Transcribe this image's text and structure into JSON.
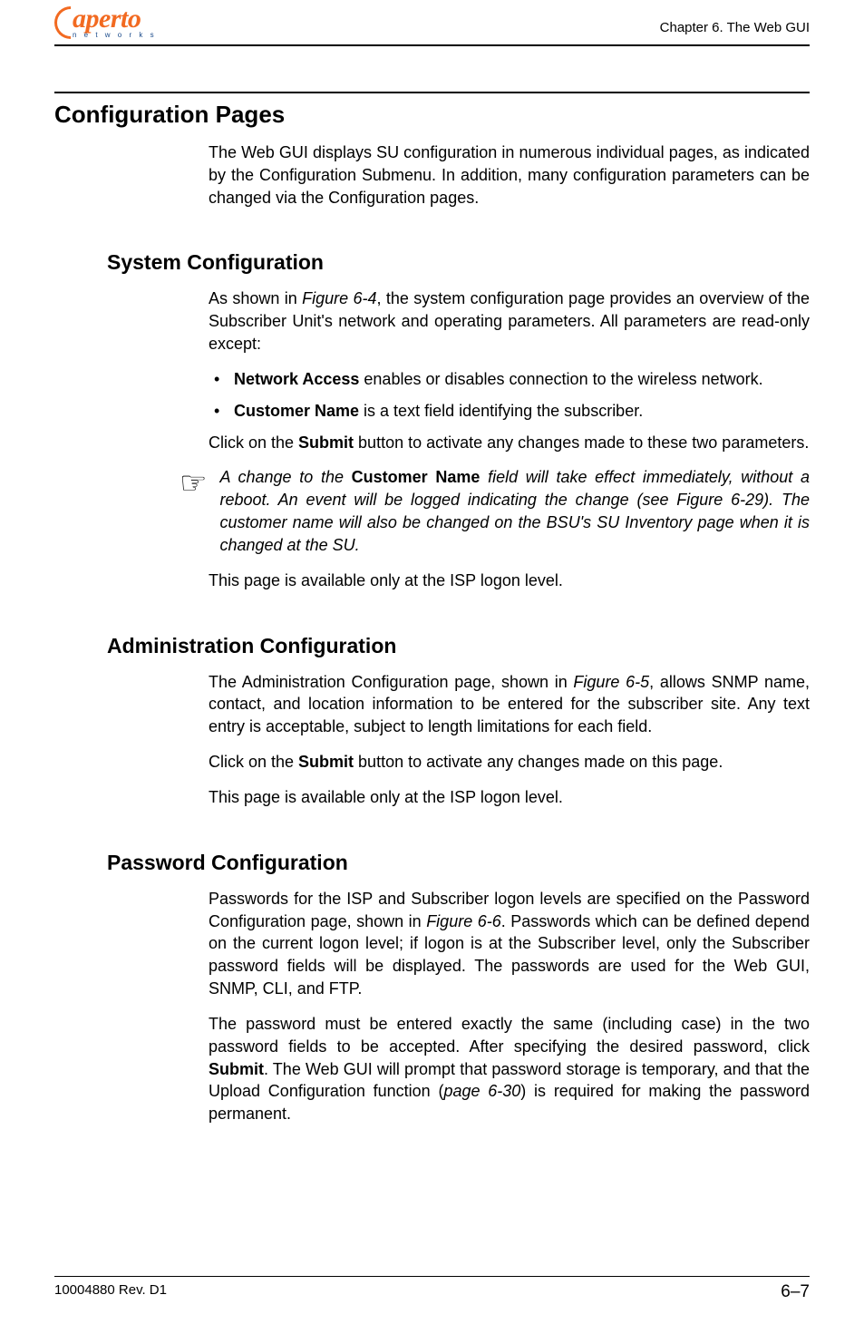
{
  "header": {
    "brand": "aperto",
    "brand_sub": "n e t w o r k s",
    "chapter": "Chapter 6.  The Web GUI"
  },
  "section": {
    "title": "Configuration Pages",
    "intro": "The Web GUI displays SU configuration in numerous individual pages, as indicated by the Configuration Submenu. In addition, many configuration parameters can be changed via the Configuration pages."
  },
  "system": {
    "title": "System Configuration",
    "p1_a": "As shown in ",
    "p1_fig": "Figure 6-4",
    "p1_b": ", the system configuration page provides an overview of the Subscriber Unit's network and operating parameters. All parameters are read-only except:",
    "bullet1_b": "Network Access",
    "bullet1_t": " enables or disables connection to the wireless network.",
    "bullet2_b": "Customer Name",
    "bullet2_t": " is a text field identifying the subscriber.",
    "p2_a": "Click on the ",
    "p2_b": "Submit",
    "p2_c": " button to activate any changes made to these two parameters.",
    "note_a": "A change to the ",
    "note_b": "Customer Name",
    "note_c": " field will take effect immediately, without a reboot. An event will be logged indicating the change (see Figure 6-29). The customer name will also be changed on the BSU's SU Inventory page when it is changed at the SU.",
    "p3": "This page is available only at the ISP logon level."
  },
  "admin": {
    "title": "Administration Configuration",
    "p1_a": "The Administration Configuration page, shown in ",
    "p1_fig": "Figure 6-5",
    "p1_b": ", allows SNMP name, contact, and location information to be entered for the subscriber site. Any text entry is acceptable, subject to length limitations for each field.",
    "p2_a": "Click on the ",
    "p2_b": "Submit",
    "p2_c": " button to activate any changes made on this page.",
    "p3": "This page is available only at the ISP logon level."
  },
  "password": {
    "title": "Password Configuration",
    "p1_a": "Passwords for the ISP and Subscriber logon levels are specified on the Password Configuration page, shown in ",
    "p1_fig": "Figure 6-6",
    "p1_b": ". Passwords which can be defined depend on the current logon level; if logon is at the Subscriber level, only the Subscriber password fields will be displayed. The passwords are used for the Web GUI, SNMP, CLI, and FTP.",
    "p2_a": "The password must be entered exactly the same (including case) in the two password fields to be accepted. After specifying the desired password, click ",
    "p2_b": "Submit",
    "p2_c": ". The Web GUI will prompt that password storage is temporary, and that the Upload Configuration function (",
    "p2_pg": "page 6-30",
    "p2_d": ") is required for making the password permanent."
  },
  "footer": {
    "rev": "10004880 Rev. D1",
    "page": "6–7"
  }
}
